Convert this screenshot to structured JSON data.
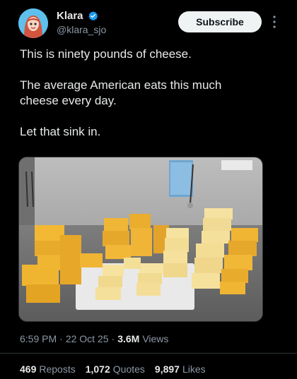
{
  "author": {
    "name": "Klara",
    "handle": "@klara_sjo",
    "avatar_icon": "avatar-icon",
    "verified_icon": "verified-badge-icon"
  },
  "subscribe_label": "Subscribe",
  "tweet": {
    "line1": "This is ninety pounds of cheese.",
    "line2": "The average American eats this much",
    "line3": "cheese every day.",
    "line4": "Let that sink in."
  },
  "meta": {
    "time": "6:59 PM",
    "sep1": "·",
    "date": "22 Oct 25",
    "sep2": "·",
    "views_count": "3.6M",
    "views_label": "Views"
  },
  "stats": [
    {
      "count": "469",
      "label": "Reposts"
    },
    {
      "count": "1,072",
      "label": "Quotes"
    },
    {
      "count": "9,897",
      "label": "Likes"
    }
  ],
  "colors": {
    "background": "#000000",
    "text": "#e7e9ea",
    "secondary": "#8b98a5",
    "verified": "#1d9bf0"
  }
}
